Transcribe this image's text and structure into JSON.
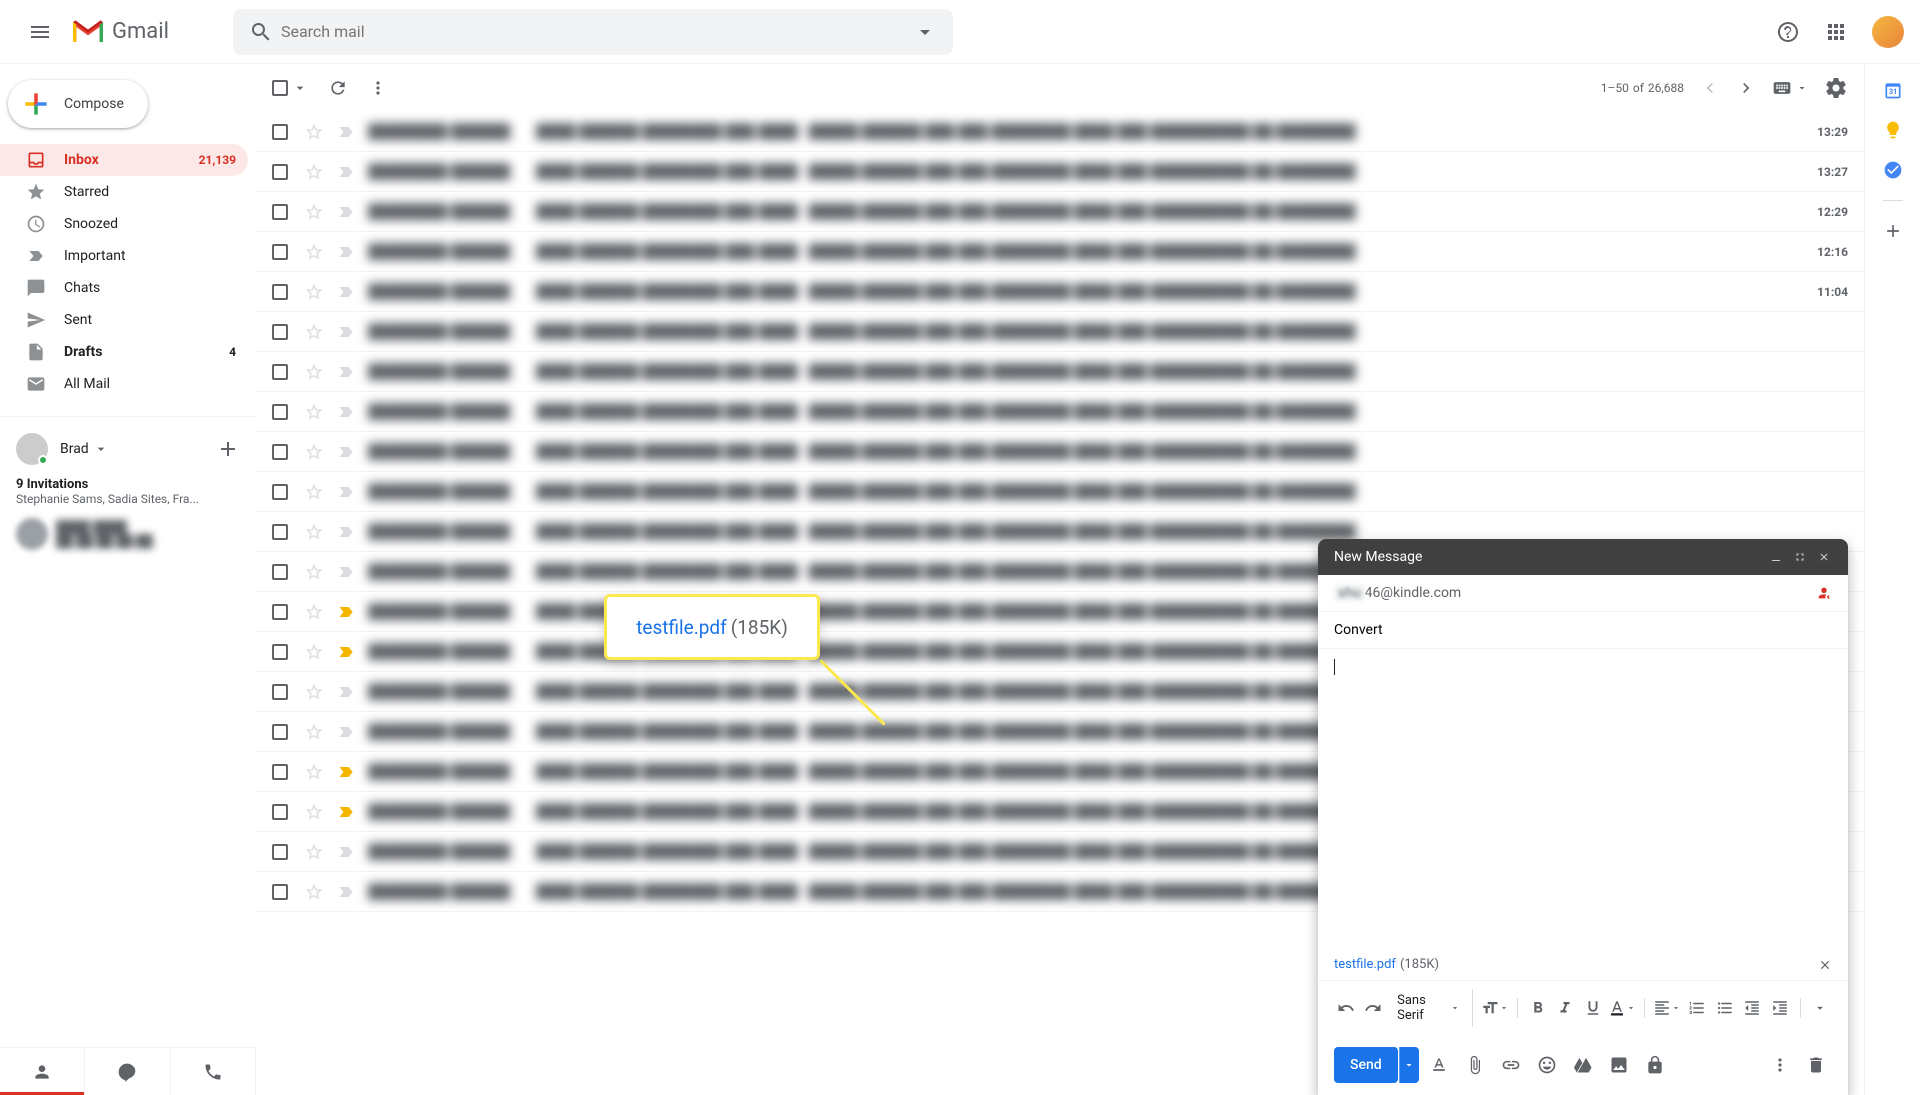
{
  "header": {
    "logo_text": "Gmail",
    "search_placeholder": "Search mail"
  },
  "compose_btn": "Compose",
  "nav": [
    {
      "label": "Inbox",
      "count": "21,139",
      "active": true,
      "bold": true
    },
    {
      "label": "Starred"
    },
    {
      "label": "Snoozed"
    },
    {
      "label": "Important"
    },
    {
      "label": "Chats"
    },
    {
      "label": "Sent"
    },
    {
      "label": "Drafts",
      "count": "4",
      "bold": true
    },
    {
      "label": "All Mail"
    }
  ],
  "hangouts": {
    "name": "Brad",
    "inv_title": "9 Invitations",
    "inv_sub": "Stephanie Sams, Sadia Sites, Fra..."
  },
  "toolbar": {
    "page_range": "1–50",
    "page_of": "of",
    "page_total": "26,688"
  },
  "mail_times": [
    "13:29",
    "13:27",
    "12:29",
    "12:16",
    "11:04"
  ],
  "compose": {
    "title": "New Message",
    "to_redacted": "shu",
    "to_rest": "46@kindle.com",
    "subject": "Convert",
    "attachment_name": "testfile.pdf",
    "attachment_size": "(185K)",
    "font": "Sans Serif",
    "send": "Send"
  },
  "callout": {
    "name": "testfile.pdf",
    "size": "(185K)"
  }
}
